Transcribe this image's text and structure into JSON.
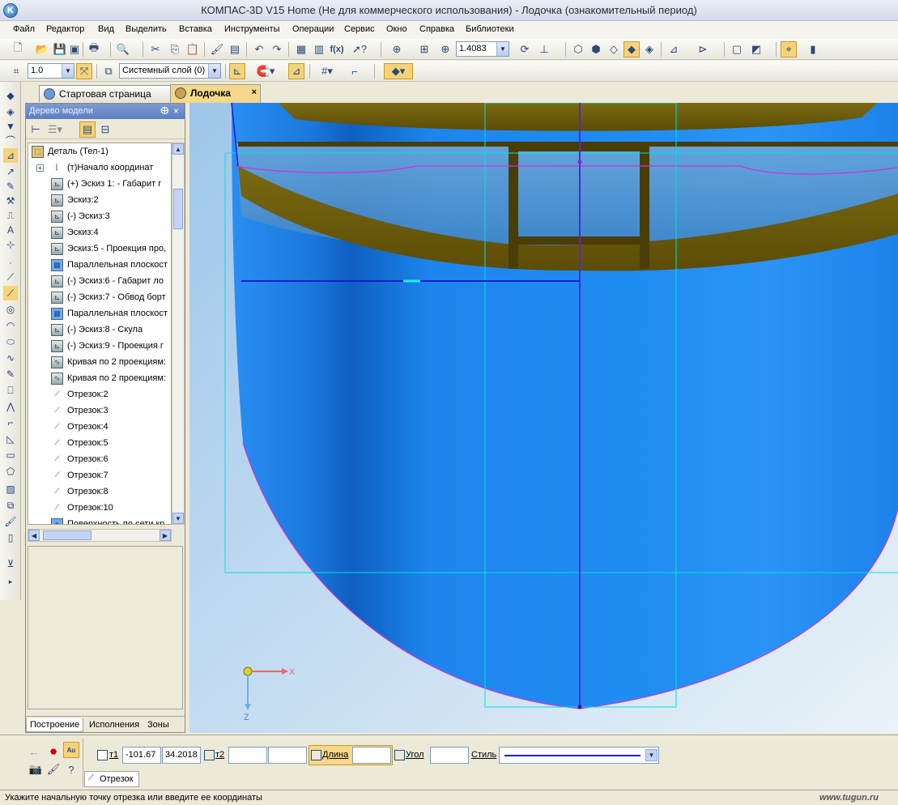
{
  "app": {
    "title": "КОМПАС-3D V15 Home (Не для коммерческого использования) - Лодочка (ознакомительный период)"
  },
  "menu": [
    "Файл",
    "Редактор",
    "Вид",
    "Выделить",
    "Вставка",
    "Инструменты",
    "Операции",
    "Сервис",
    "Окно",
    "Справка",
    "Библиотеки"
  ],
  "toolbar": {
    "zoom_value": "1.4083",
    "line_scale": "1.0",
    "layer": "Системный слой (0)"
  },
  "tabs": [
    {
      "label": "Стартовая страница"
    },
    {
      "label": "Лодочка",
      "close": "×"
    }
  ],
  "tree": {
    "panel_title": "Дерево модели",
    "pin": "ⴲ",
    "close": "×",
    "items": [
      {
        "label": "Деталь (Тел-1)",
        "icon": "part-icon"
      },
      {
        "label": "(т)Начало координат",
        "icon": "origin-icon"
      },
      {
        "label": "(+) Эскиз 1: - Габарит г",
        "icon": "sketch-icon"
      },
      {
        "label": "Эскиз:2",
        "icon": "sketch-icon"
      },
      {
        "label": "(-) Эскиз:3",
        "icon": "sketch-icon"
      },
      {
        "label": "Эскиз:4",
        "icon": "sketch-icon"
      },
      {
        "label": "Эскиз:5 - Проекция про,",
        "icon": "sketch-icon"
      },
      {
        "label": "Параллельная плоскост",
        "icon": "plane-icon"
      },
      {
        "label": "(-) Эскиз:6 - Габарит ло",
        "icon": "sketch-icon"
      },
      {
        "label": "(-) Эскиз:7 - Обвод борт",
        "icon": "sketch-icon"
      },
      {
        "label": "Параллельная плоскост",
        "icon": "plane-icon"
      },
      {
        "label": "(-) Эскиз:8 - Скула",
        "icon": "sketch-icon"
      },
      {
        "label": "(-) Эскиз:9 - Проекция г",
        "icon": "sketch-icon"
      },
      {
        "label": "Кривая по 2 проекциям:",
        "icon": "curve-icon"
      },
      {
        "label": "Кривая по 2 проекциям:",
        "icon": "curve-icon"
      },
      {
        "label": "Отрезок:2",
        "icon": "segment-icon"
      },
      {
        "label": "Отрезок:3",
        "icon": "segment-icon"
      },
      {
        "label": "Отрезок:4",
        "icon": "segment-icon"
      },
      {
        "label": "Отрезок:5",
        "icon": "segment-icon"
      },
      {
        "label": "Отрезок:6",
        "icon": "segment-icon"
      },
      {
        "label": "Отрезок:7",
        "icon": "segment-icon"
      },
      {
        "label": "Отрезок:8",
        "icon": "segment-icon"
      },
      {
        "label": "Отрезок:10",
        "icon": "segment-icon"
      },
      {
        "label": "Поверхность по сети кр",
        "icon": "surface-icon"
      }
    ],
    "bottom_tabs": [
      "Построение",
      "Исполнения",
      "Зоны"
    ]
  },
  "viewport": {
    "axis_x": "X",
    "axis_z": "Z",
    "colors": {
      "hull": "#1e8cf0",
      "deck": "#6a5a0a",
      "grid": "#00e0e0",
      "sketch": "#1a1ad8"
    }
  },
  "props": {
    "t1_label": "т1",
    "t1_x": "-101.67",
    "t1_y": "34.2018",
    "t2_label": "т2",
    "length_label": "Длина",
    "angle_label": "Угол",
    "style_label": "Стиль",
    "command_tab": "Отрезок"
  },
  "status": {
    "hint": "Укажите начальную точку отрезка или введите ее координаты",
    "watermark": "www.tugun.ru"
  }
}
